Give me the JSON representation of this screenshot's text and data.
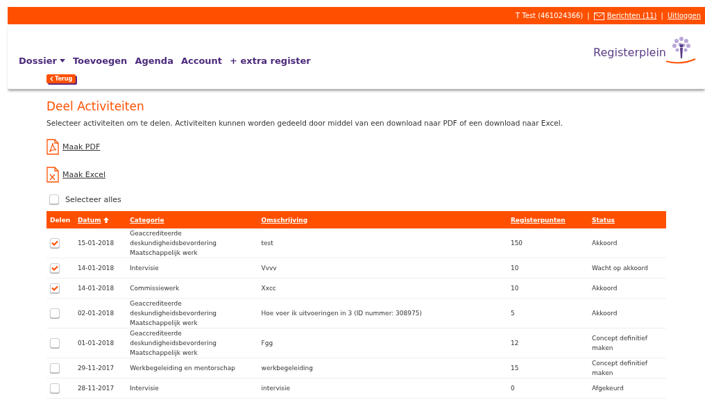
{
  "top_bar": {
    "user": "T Test (461024366)",
    "separator_1": "|",
    "messages_link": "Berichten (11)",
    "separator_2": "|",
    "logout_link": "Uitloggen"
  },
  "logo": {
    "text": "Registerplein"
  },
  "nav": [
    {
      "label": "Dossier",
      "dropdown": true
    },
    {
      "label": "Toevoegen",
      "dropdown": false
    },
    {
      "label": "Agenda",
      "dropdown": false
    },
    {
      "label": "Account",
      "dropdown": false
    },
    {
      "label": "+ extra register",
      "dropdown": false
    }
  ],
  "back_button": "Terug",
  "title": "Deel Activiteiten",
  "intro": "Selecteer activiteiten om te delen. Activiteiten kunnen worden gedeeld door middel van een download naar PDF of een download naar Excel.",
  "downloads": [
    {
      "kind": "pdf",
      "label": "Maak PDF"
    },
    {
      "kind": "excel",
      "label": "Maak Excel"
    }
  ],
  "select_all": {
    "label": "Selecteer alles",
    "checked": false
  },
  "table": {
    "columns": [
      {
        "label": "Delen",
        "link": false,
        "sorted": false
      },
      {
        "label": "Datum",
        "link": true,
        "sorted": true
      },
      {
        "label": "Categorie",
        "link": true,
        "sorted": false
      },
      {
        "label": "Omschrijving",
        "link": true,
        "sorted": false
      },
      {
        "label": "Registerpunten",
        "link": true,
        "sorted": false
      },
      {
        "label": "Status",
        "link": true,
        "sorted": false
      }
    ],
    "rows": [
      {
        "checked": true,
        "date": "15-01-2018",
        "category": [
          "Geaccrediteerde",
          "deskundigheidsbevordering",
          "Maatschappelijk werk"
        ],
        "description": "test",
        "points": "150",
        "status": "Akkoord"
      },
      {
        "checked": true,
        "date": "14-01-2018",
        "category": [
          "Intervisie"
        ],
        "description": "Vvvv",
        "points": "10",
        "status": "Wacht op akkoord"
      },
      {
        "checked": true,
        "date": "14-01-2018",
        "category": [
          "Commissiewerk"
        ],
        "description": "Xxcc",
        "points": "10",
        "status": "Akkoord"
      },
      {
        "checked": false,
        "date": "02-01-2018",
        "category": [
          "Geaccrediteerde",
          "deskundigheidsbevordering",
          "Maatschappelijk werk"
        ],
        "description": "Hoe voer ik uitvoeringen in 3 (ID nummer: 308975)",
        "points": "5",
        "status": "Akkoord"
      },
      {
        "checked": false,
        "date": "01-01-2018",
        "category": [
          "Geaccrediteerde",
          "deskundigheidsbevordering",
          "Maatschappelijk werk"
        ],
        "description": "Fgg",
        "points": "12",
        "status": "Concept definitief maken"
      },
      {
        "checked": false,
        "date": "29-11-2017",
        "category": [
          "Werkbegeleiding en mentorschap"
        ],
        "description": "werkbegeleiding",
        "points": "15",
        "status": "Concept definitief maken"
      },
      {
        "checked": false,
        "date": "28-11-2017",
        "category": [
          "Intervisie"
        ],
        "description": "intervisie",
        "points": "0",
        "status": "Afgekeurd"
      }
    ]
  }
}
